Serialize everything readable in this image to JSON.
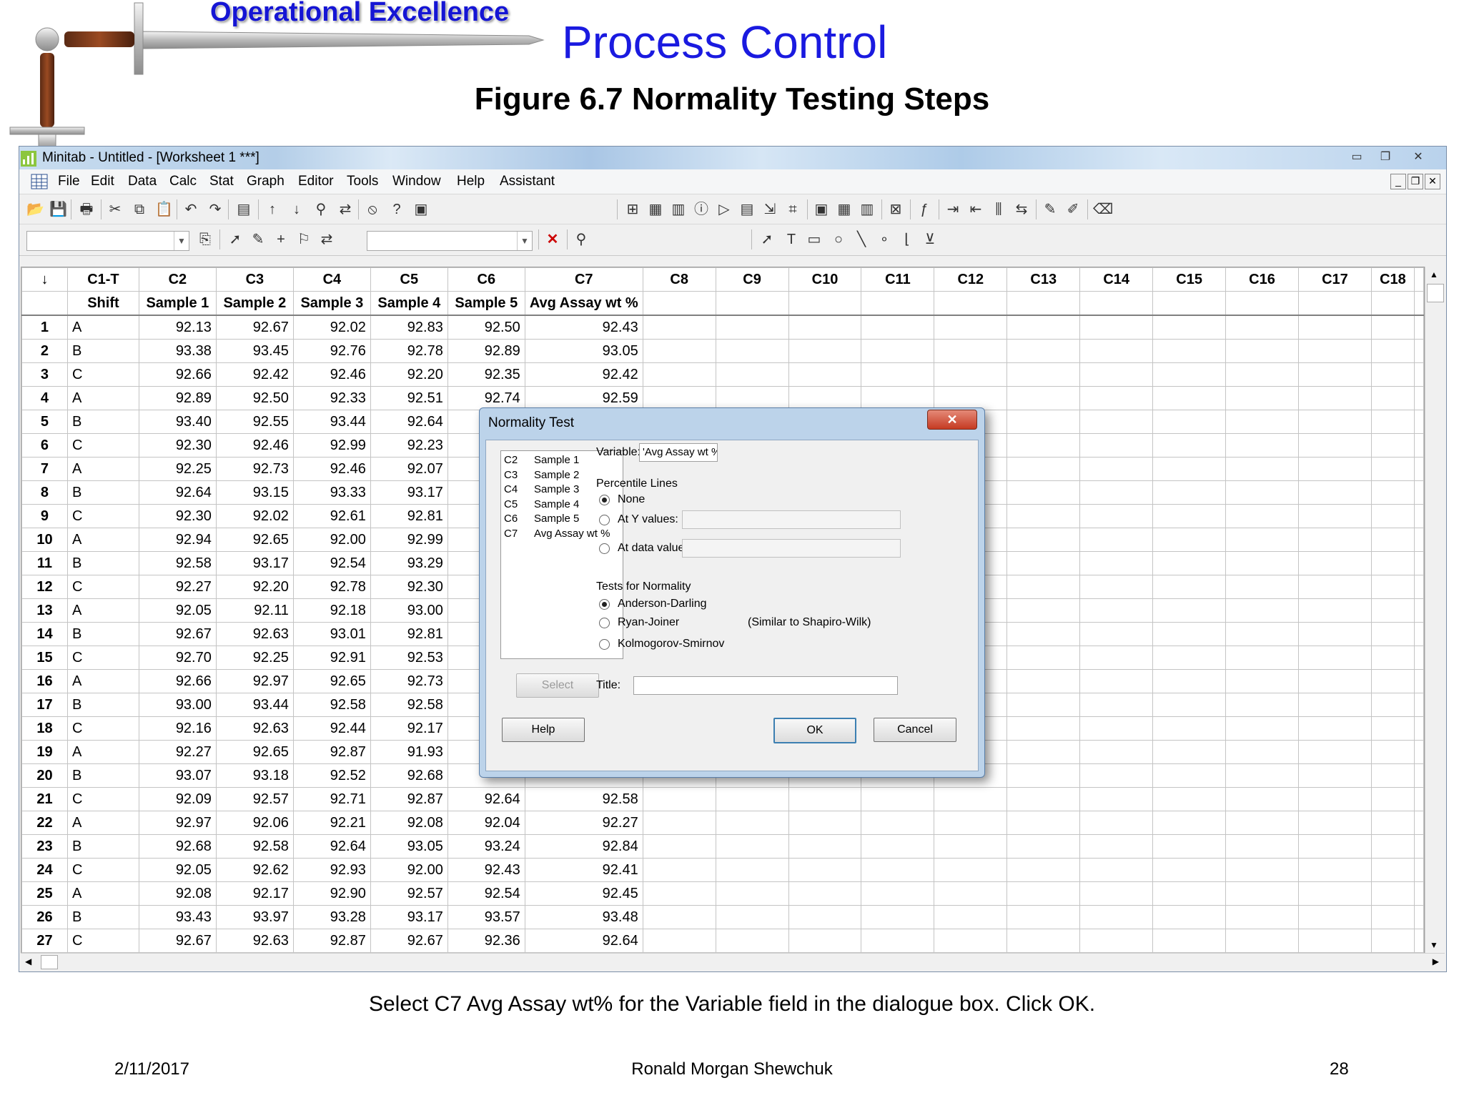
{
  "slide": {
    "brand": "Operational Excellence",
    "title": "Process Control",
    "figure_title": "Figure 6.7  Normality Testing Steps",
    "caption": "Select C7 Avg Assay wt% for the Variable field in the dialogue box.  Click OK.",
    "footer_date": "2/11/2017",
    "footer_author": "Ronald Morgan Shewchuk",
    "footer_page": "28"
  },
  "window": {
    "title": "Minitab - Untitled - [Worksheet 1 ***]",
    "menus": [
      "File",
      "Edit",
      "Data",
      "Calc",
      "Stat",
      "Graph",
      "Editor",
      "Tools",
      "Window",
      "Help",
      "Assistant"
    ]
  },
  "worksheet": {
    "corner": "↓",
    "columns": [
      "C1-T",
      "C2",
      "C3",
      "C4",
      "C5",
      "C6",
      "C7",
      "C8",
      "C9",
      "C10",
      "C11",
      "C12",
      "C13",
      "C14",
      "C15",
      "C16",
      "C17",
      "C18"
    ],
    "names": [
      "Shift",
      "Sample 1",
      "Sample 2",
      "Sample 3",
      "Sample 4",
      "Sample 5",
      "Avg Assay wt %",
      "",
      "",
      "",
      "",
      "",
      "",
      "",
      "",
      "",
      "",
      ""
    ],
    "rows": [
      [
        "1",
        "A",
        "92.13",
        "92.67",
        "92.02",
        "92.83",
        "92.50",
        "92.43"
      ],
      [
        "2",
        "B",
        "93.38",
        "93.45",
        "92.76",
        "92.78",
        "92.89",
        "93.05"
      ],
      [
        "3",
        "C",
        "92.66",
        "92.42",
        "92.46",
        "92.20",
        "92.35",
        "92.42"
      ],
      [
        "4",
        "A",
        "92.89",
        "92.50",
        "92.33",
        "92.51",
        "92.74",
        "92.59"
      ],
      [
        "5",
        "B",
        "93.40",
        "92.55",
        "93.44",
        "92.64",
        "",
        ""
      ],
      [
        "6",
        "C",
        "92.30",
        "92.46",
        "92.99",
        "92.23",
        "",
        ""
      ],
      [
        "7",
        "A",
        "92.25",
        "92.73",
        "92.46",
        "92.07",
        "",
        ""
      ],
      [
        "8",
        "B",
        "92.64",
        "93.15",
        "93.33",
        "93.17",
        "",
        ""
      ],
      [
        "9",
        "C",
        "92.30",
        "92.02",
        "92.61",
        "92.81",
        "",
        ""
      ],
      [
        "10",
        "A",
        "92.94",
        "92.65",
        "92.00",
        "92.99",
        "",
        ""
      ],
      [
        "11",
        "B",
        "92.58",
        "93.17",
        "92.54",
        "93.29",
        "",
        ""
      ],
      [
        "12",
        "C",
        "92.27",
        "92.20",
        "92.78",
        "92.30",
        "",
        ""
      ],
      [
        "13",
        "A",
        "92.05",
        "92.11",
        "92.18",
        "93.00",
        "",
        ""
      ],
      [
        "14",
        "B",
        "92.67",
        "92.63",
        "93.01",
        "92.81",
        "",
        ""
      ],
      [
        "15",
        "C",
        "92.70",
        "92.25",
        "92.91",
        "92.53",
        "",
        ""
      ],
      [
        "16",
        "A",
        "92.66",
        "92.97",
        "92.65",
        "92.73",
        "",
        ""
      ],
      [
        "17",
        "B",
        "93.00",
        "93.44",
        "92.58",
        "92.58",
        "",
        ""
      ],
      [
        "18",
        "C",
        "92.16",
        "92.63",
        "92.44",
        "92.17",
        "",
        ""
      ],
      [
        "19",
        "A",
        "92.27",
        "92.65",
        "92.87",
        "91.93",
        "",
        ""
      ],
      [
        "20",
        "B",
        "93.07",
        "93.18",
        "92.52",
        "92.68",
        "",
        ""
      ],
      [
        "21",
        "C",
        "92.09",
        "92.57",
        "92.71",
        "92.87",
        "92.64",
        "92.58"
      ],
      [
        "22",
        "A",
        "92.97",
        "92.06",
        "92.21",
        "92.08",
        "92.04",
        "92.27"
      ],
      [
        "23",
        "B",
        "92.68",
        "92.58",
        "92.64",
        "93.05",
        "93.24",
        "92.84"
      ],
      [
        "24",
        "C",
        "92.05",
        "92.62",
        "92.93",
        "92.00",
        "92.43",
        "92.41"
      ],
      [
        "25",
        "A",
        "92.08",
        "92.17",
        "92.90",
        "92.57",
        "92.54",
        "92.45"
      ],
      [
        "26",
        "B",
        "93.43",
        "93.97",
        "93.28",
        "93.17",
        "93.57",
        "93.48"
      ],
      [
        "27",
        "C",
        "92.67",
        "92.63",
        "92.87",
        "92.67",
        "92.36",
        "92.64"
      ]
    ]
  },
  "dialog": {
    "title": "Normality Test",
    "close": "✕",
    "variables": [
      {
        "col": "C2",
        "name": "Sample 1"
      },
      {
        "col": "C3",
        "name": "Sample 2"
      },
      {
        "col": "C4",
        "name": "Sample 3"
      },
      {
        "col": "C5",
        "name": "Sample 4"
      },
      {
        "col": "C6",
        "name": "Sample 5"
      },
      {
        "col": "C7",
        "name": "Avg Assay wt %"
      }
    ],
    "variable_label": "Variable:",
    "variable_value": "'Avg Assay wt %'",
    "percentile_label": "Percentile Lines",
    "opt_none": "None",
    "opt_at_y": "At Y values:",
    "opt_at_data": "At data values:",
    "tests_label": "Tests for Normality",
    "opt_ad": "Anderson-Darling",
    "opt_rj": "Ryan-Joiner",
    "rj_note": "(Similar to Shapiro-Wilk)",
    "opt_ks": "Kolmogorov-Smirnov",
    "select_btn": "Select",
    "title_label": "Title:",
    "help_btn": "Help",
    "ok_btn": "OK",
    "cancel_btn": "Cancel"
  },
  "colors": {
    "brand_blue": "#1515d4",
    "title_blue": "#1a1ae0",
    "dialog_frame": "#bcd3ea",
    "close_red": "#c53a22"
  }
}
